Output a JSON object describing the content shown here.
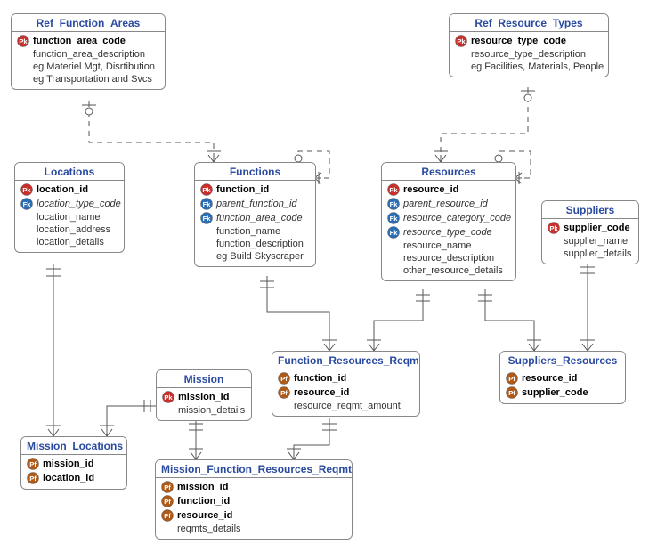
{
  "entities": {
    "ref_function_areas": {
      "title": "Ref_Function_Areas",
      "rows": [
        {
          "icon": "PK",
          "text": "function_area_code",
          "bold": true
        },
        {
          "icon": "",
          "text": "function_area_description"
        },
        {
          "icon": "",
          "text": "eg Materiel Mgt, Disrtibution"
        },
        {
          "icon": "",
          "text": "eg Transportation and Svcs"
        }
      ]
    },
    "ref_resource_types": {
      "title": "Ref_Resource_Types",
      "rows": [
        {
          "icon": "PK",
          "text": "resource_type_code",
          "bold": true
        },
        {
          "icon": "",
          "text": "resource_type_description"
        },
        {
          "icon": "",
          "text": "eg Facilities, Materials, People"
        }
      ]
    },
    "locations": {
      "title": "Locations",
      "rows": [
        {
          "icon": "PK",
          "text": "location_id",
          "bold": true
        },
        {
          "icon": "FK",
          "text": "location_type_code",
          "italic": true
        },
        {
          "icon": "",
          "text": "location_name"
        },
        {
          "icon": "",
          "text": "location_address"
        },
        {
          "icon": "",
          "text": "location_details"
        }
      ]
    },
    "functions": {
      "title": "Functions",
      "rows": [
        {
          "icon": "PK",
          "text": "function_id",
          "bold": true
        },
        {
          "icon": "FK",
          "text": "parent_function_id",
          "italic": true
        },
        {
          "icon": "FK",
          "text": "function_area_code",
          "italic": true
        },
        {
          "icon": "",
          "text": "function_name"
        },
        {
          "icon": "",
          "text": "function_description"
        },
        {
          "icon": "",
          "text": "eg Build Skyscraper"
        }
      ]
    },
    "resources": {
      "title": "Resources",
      "rows": [
        {
          "icon": "PK",
          "text": "resource_id",
          "bold": true
        },
        {
          "icon": "FK",
          "text": "parent_resource_id",
          "italic": true
        },
        {
          "icon": "FK",
          "text": "resource_category_code",
          "italic": true
        },
        {
          "icon": "FK",
          "text": "resource_type_code",
          "italic": true
        },
        {
          "icon": "",
          "text": "resource_name"
        },
        {
          "icon": "",
          "text": "resource_description"
        },
        {
          "icon": "",
          "text": "other_resource_details"
        }
      ]
    },
    "suppliers": {
      "title": "Suppliers",
      "rows": [
        {
          "icon": "PK",
          "text": "supplier_code",
          "bold": true
        },
        {
          "icon": "",
          "text": "supplier_name"
        },
        {
          "icon": "",
          "text": "supplier_details"
        }
      ]
    },
    "mission": {
      "title": "Mission",
      "rows": [
        {
          "icon": "PK",
          "text": "mission_id",
          "bold": true
        },
        {
          "icon": "",
          "text": "mission_details"
        }
      ]
    },
    "function_resources_reqmts": {
      "title": "Function_Resources_Reqmts",
      "rows": [
        {
          "icon": "PF",
          "text": "function_id",
          "bold": true
        },
        {
          "icon": "PF",
          "text": "resource_id",
          "bold": true
        },
        {
          "icon": "",
          "text": "resource_reqmt_amount"
        }
      ]
    },
    "suppliers_resources": {
      "title": "Suppliers_Resources",
      "rows": [
        {
          "icon": "PF",
          "text": "resource_id",
          "bold": true
        },
        {
          "icon": "PF",
          "text": "supplier_code",
          "bold": true
        }
      ]
    },
    "mission_locations": {
      "title": "Mission_Locations",
      "rows": [
        {
          "icon": "PF",
          "text": "mission_id",
          "bold": true
        },
        {
          "icon": "PF",
          "text": "location_id",
          "bold": true
        }
      ]
    },
    "mission_function_resources_reqmts": {
      "title": "Mission_Function_Resources_Reqmts",
      "rows": [
        {
          "icon": "PF",
          "text": "mission_id",
          "bold": true
        },
        {
          "icon": "PF",
          "text": "function_id",
          "bold": true
        },
        {
          "icon": "PF",
          "text": "resource_id",
          "bold": true
        },
        {
          "icon": "",
          "text": "reqmts_details"
        }
      ]
    }
  }
}
